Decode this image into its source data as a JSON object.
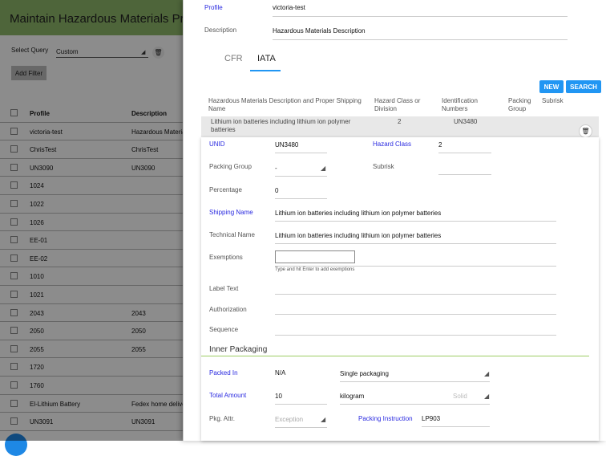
{
  "background": {
    "title": "Maintain Hazardous Materials Profiles",
    "select_query_label": "Select Query",
    "select_query_value": "Custom",
    "add_filter_label": "Add Filter",
    "table_headers": [
      "Profile",
      "Description"
    ],
    "rows": [
      {
        "profile": "victoria-test",
        "description": "Hazardous Materials Description"
      },
      {
        "profile": "ChrisTest",
        "description": "ChrisTest"
      },
      {
        "profile": "UN3090",
        "description": "UN3090"
      },
      {
        "profile": "1024",
        "description": ""
      },
      {
        "profile": "1022",
        "description": ""
      },
      {
        "profile": "1026",
        "description": ""
      },
      {
        "profile": "EE-01",
        "description": ""
      },
      {
        "profile": "EE-02",
        "description": ""
      },
      {
        "profile": "1010",
        "description": ""
      },
      {
        "profile": "1021",
        "description": ""
      },
      {
        "profile": "2043",
        "description": "2043"
      },
      {
        "profile": "2050",
        "description": "2050"
      },
      {
        "profile": "2055",
        "description": "2055"
      },
      {
        "profile": "1720",
        "description": ""
      },
      {
        "profile": "1760",
        "description": ""
      },
      {
        "profile": "El-Lithium Battery",
        "description": "Fedex home delivery"
      },
      {
        "profile": "UN3091",
        "description": "UN3091"
      }
    ]
  },
  "panel": {
    "profile_label": "Profile",
    "profile_value": "victoria-test",
    "description_label": "Description",
    "description_value": "Hazardous Materials Description",
    "tabs": [
      "CFR",
      "IATA"
    ],
    "active_tab": "IATA",
    "new_button": "NEW",
    "search_button": "SEARCH",
    "columns": {
      "desc": "Hazardous Materials Description and Proper Shipping Name",
      "hazard_class": "Hazard Class or Division",
      "id_numbers": "Identification Numbers",
      "packing_group": "Packing Group",
      "subrisk": "Subrisk"
    },
    "selected_row": {
      "desc": "Lithium ion batteries including lithium ion polymer batteries",
      "hazard_class": "2",
      "id_number": "UN3480"
    },
    "form": {
      "unid_label": "UNID",
      "unid_value": "UN3480",
      "hazard_class_label": "Hazard Class",
      "hazard_class_value": "2",
      "packing_group_label": "Packing Group",
      "packing_group_value": "-",
      "subrisk_label": "Subrisk",
      "percentage_label": "Percentage",
      "percentage_value": "0",
      "shipping_name_label": "Shipping Name",
      "shipping_name_value": "Lithium ion batteries including lithium ion polymer batteries",
      "technical_name_label": "Technical Name",
      "technical_name_value": "Lithium ion batteries including lithium ion polymer batteries",
      "exemptions_label": "Exemptions",
      "exemptions_hint": "Type and hit Enter to add exemptions",
      "label_text_label": "Label Text",
      "authorization_label": "Authorization",
      "sequence_label": "Sequence"
    },
    "inner_packaging": {
      "title": "Inner Packaging",
      "packed_in_label": "Packed In",
      "packed_in_value": "N/A",
      "packaging_type_value": "Single packaging",
      "total_amount_label": "Total Amount",
      "total_amount_value": "10",
      "unit_value": "kilogram",
      "state_value": "Solid",
      "pkg_attr_label": "Pkg. Attr.",
      "pkg_attr_placeholder": "Exception",
      "packing_instruction_label": "Packing Instruction",
      "packing_instruction_value": "LP903"
    }
  },
  "colors": {
    "header_green": "#8fb86a",
    "accent_blue": "#2196f3",
    "link_blue": "#2a2ae0"
  }
}
